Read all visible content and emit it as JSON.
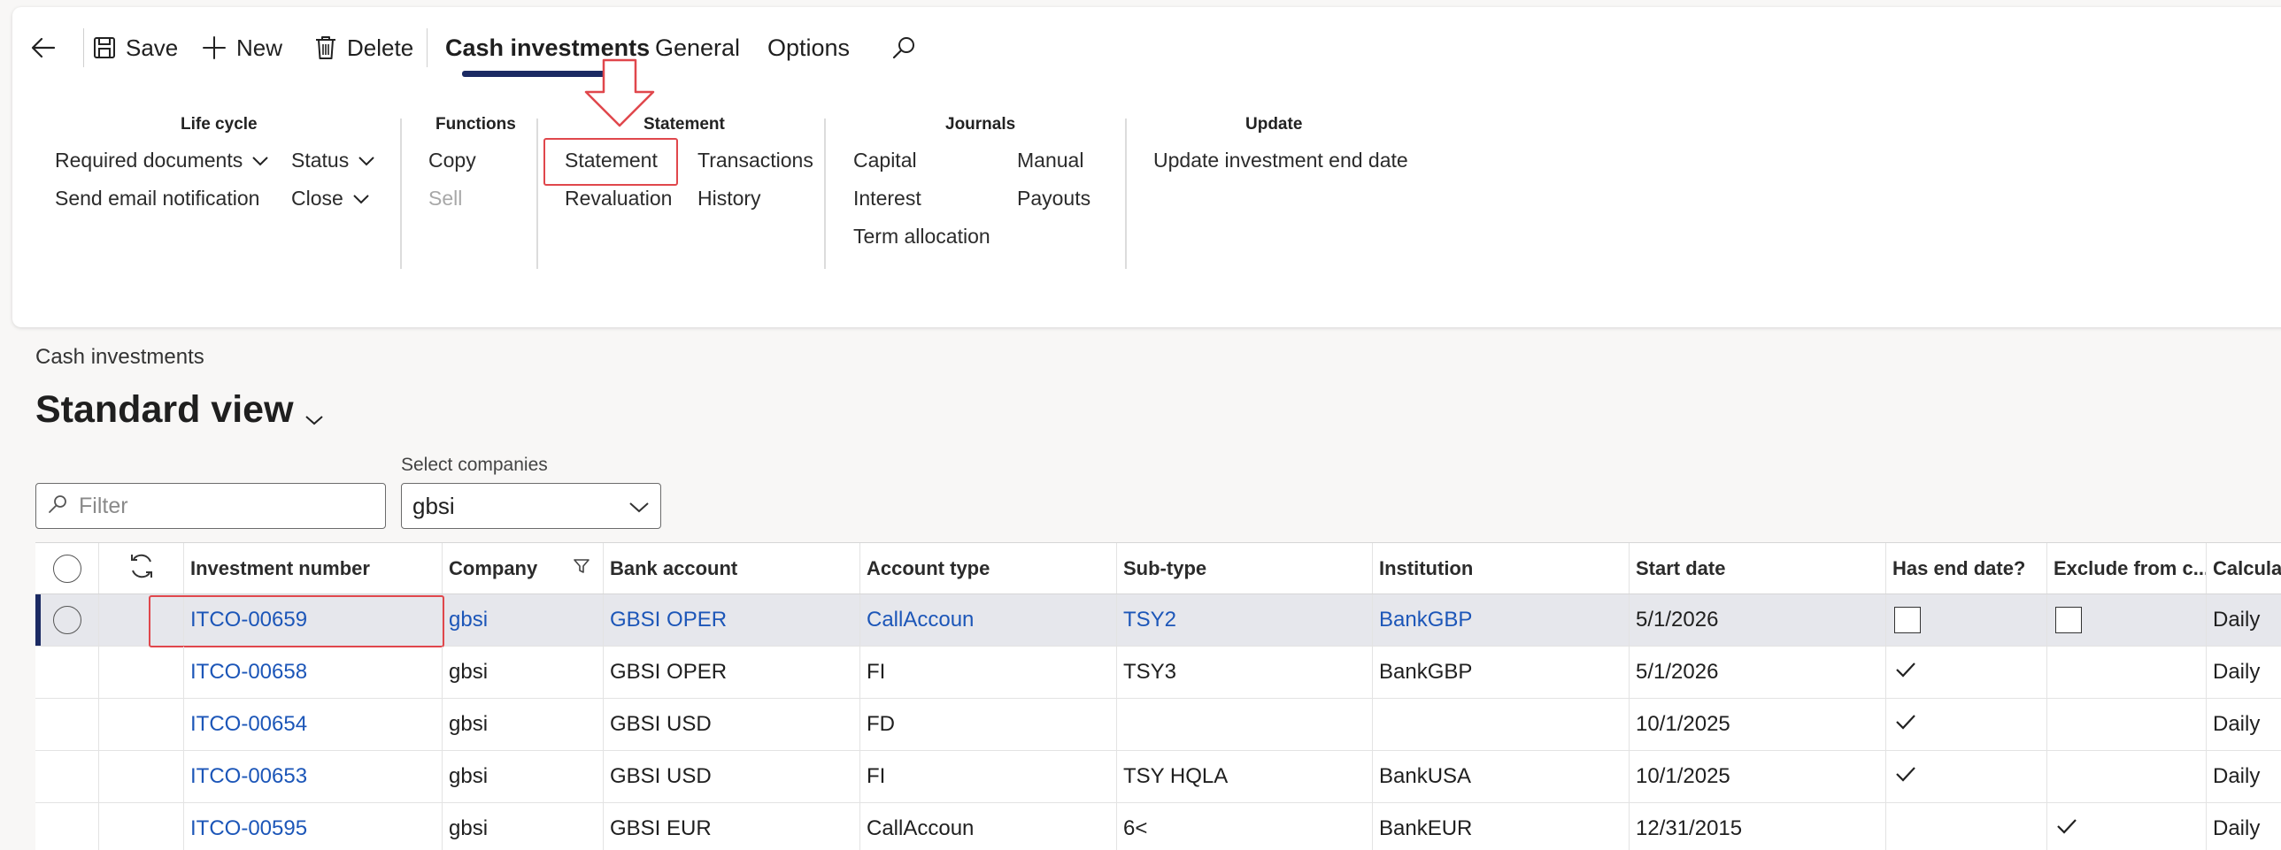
{
  "toolbar": {
    "back_icon": "back-arrow-icon",
    "save_label": "Save",
    "new_label": "New",
    "delete_label": "Delete",
    "tabs": [
      "Cash investments",
      "General",
      "Options"
    ],
    "active_tab": "Cash investments",
    "search_icon": "search-icon",
    "accent_color": "#1b2a63"
  },
  "ribbon": {
    "lifecycle": {
      "title": "Life cycle",
      "required_documents": "Required documents",
      "send_email": "Send email notification",
      "status": "Status",
      "close": "Close"
    },
    "functions": {
      "title": "Functions",
      "copy": "Copy",
      "sell": "Sell"
    },
    "statement": {
      "title": "Statement",
      "statement": "Statement",
      "transactions": "Transactions",
      "revaluation": "Revaluation",
      "history": "History"
    },
    "journals": {
      "title": "Journals",
      "capital": "Capital",
      "manual": "Manual",
      "interest": "Interest",
      "payouts": "Payouts",
      "term_allocation": "Term allocation"
    },
    "update": {
      "title": "Update",
      "update_end_date": "Update investment end date"
    }
  },
  "page": {
    "breadcrumb": "Cash investments",
    "view_title": "Standard view",
    "filter_placeholder": "Filter",
    "select_companies_label": "Select companies",
    "select_companies_value": "gbsi"
  },
  "grid": {
    "headers": {
      "investment_number": "Investment number",
      "company": "Company",
      "bank_account": "Bank account",
      "account_type": "Account type",
      "sub_type": "Sub-type",
      "institution": "Institution",
      "start_date": "Start date",
      "has_end_date": "Has end date?",
      "exclude": "Exclude from c...",
      "calculation": "Calculation"
    },
    "rows": [
      {
        "investment_number": "ITCO-00659",
        "company": "gbsi",
        "bank_account": "GBSI OPER",
        "account_type": "CallAccoun",
        "sub_type": "TSY2",
        "institution": "BankGBP",
        "start_date": "5/1/2026",
        "calculation": "Daily"
      },
      {
        "investment_number": "ITCO-00658",
        "company": "gbsi",
        "bank_account": "GBSI OPER",
        "account_type": "FI",
        "sub_type": "TSY3",
        "institution": "BankGBP",
        "start_date": "5/1/2026",
        "calculation": "Daily"
      },
      {
        "investment_number": "ITCO-00654",
        "company": "gbsi",
        "bank_account": "GBSI USD",
        "account_type": "FD",
        "sub_type": "",
        "institution": "",
        "start_date": "10/1/2025",
        "calculation": "Daily"
      },
      {
        "investment_number": "ITCO-00653",
        "company": "gbsi",
        "bank_account": "GBSI USD",
        "account_type": "FI",
        "sub_type": "TSY HQLA",
        "institution": "BankUSA",
        "start_date": "10/1/2025",
        "calculation": "Daily"
      },
      {
        "investment_number": "ITCO-00595",
        "company": "gbsi",
        "bank_account": "GBSI EUR",
        "account_type": "CallAccoun",
        "sub_type": "6<",
        "institution": "BankEUR",
        "start_date": "12/31/2015",
        "calculation": "Daily"
      }
    ]
  }
}
